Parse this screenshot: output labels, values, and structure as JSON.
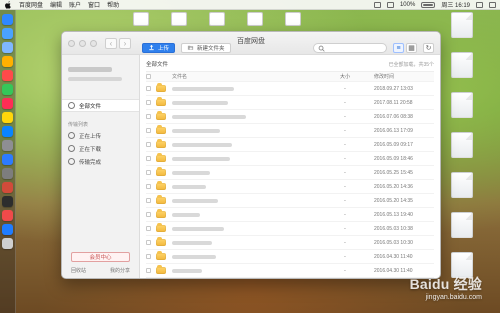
{
  "menubar": {
    "app_name": "百度网盘",
    "items": [
      "编辑",
      "账户",
      "窗口",
      "帮助"
    ],
    "time_text": "周三 16:19",
    "battery_text": "100%",
    "status_icons": [
      "wifi-icon",
      "volume-icon",
      "battery-icon",
      "spotlight-icon",
      "notification-icon"
    ]
  },
  "window": {
    "title": "百度网盘",
    "toolbar": {
      "upload_label": "上传",
      "new_folder_label": "新建文件夹",
      "search_placeholder": ""
    },
    "sidebar": {
      "all_files_label": "全部文件",
      "transfer_section_title": "传输列表",
      "uploading_label": "正在上传",
      "downloading_label": "正在下载",
      "transfer_done_label": "传输完成",
      "member_center_label": "会员中心",
      "recycle_bin_label": "回收站",
      "my_share_label": "我的分享"
    },
    "main": {
      "path_label": "全部文件",
      "loaded_count_text": "已全部加载，共35个",
      "columns": {
        "name": "文件名",
        "size": "大小",
        "modified": "修改时间"
      },
      "rows": [
        {
          "size": "-",
          "time": "2018.09.27 13:03"
        },
        {
          "size": "-",
          "time": "2017.08.11 20:58"
        },
        {
          "size": "-",
          "time": "2016.07.06 08:38"
        },
        {
          "size": "-",
          "time": "2016.06.13 17:09"
        },
        {
          "size": "-",
          "time": "2016.05.09 09:17"
        },
        {
          "size": "-",
          "time": "2016.05.09 18:46"
        },
        {
          "size": "-",
          "time": "2016.05.25 15:45"
        },
        {
          "size": "-",
          "time": "2016.05.20 14:36"
        },
        {
          "size": "-",
          "time": "2016.05.20 14:35"
        },
        {
          "size": "-",
          "time": "2016.05.13 19:40"
        },
        {
          "size": "-",
          "time": "2016.05.03 10:38"
        },
        {
          "size": "-",
          "time": "2016.05.03 10:30"
        },
        {
          "size": "-",
          "time": "2016.04.30 11:40"
        },
        {
          "size": "-",
          "time": "2016.04.30 11:40"
        }
      ]
    }
  },
  "watermark": {
    "main": "Baidu 经验",
    "sub": "jingyan.baidu.com"
  }
}
